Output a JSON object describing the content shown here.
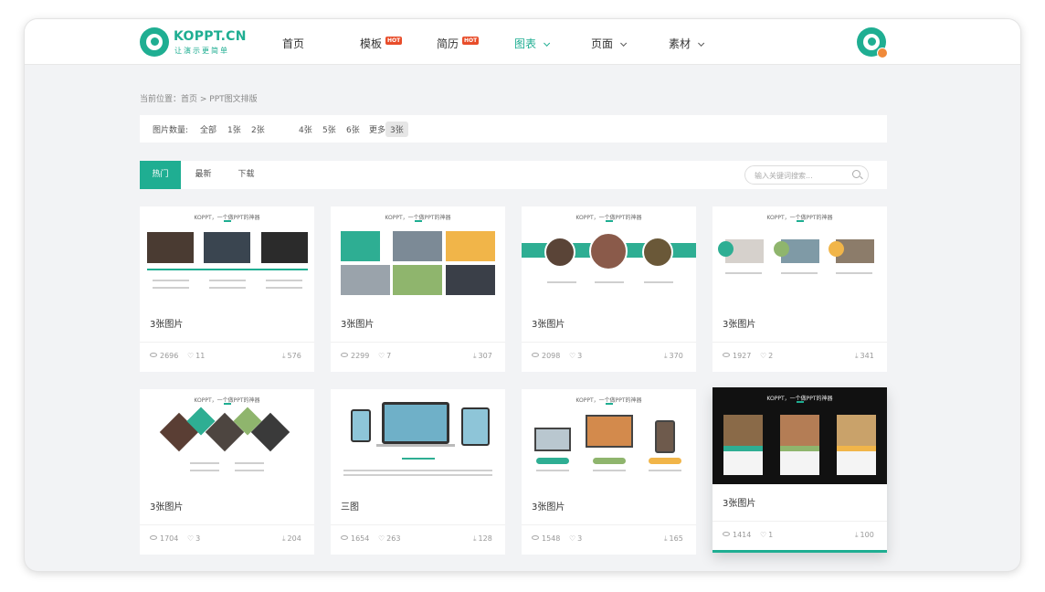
{
  "header": {
    "logo": {
      "title": "KOPPT.CN",
      "tagline": "让演示更简单"
    },
    "nav": [
      {
        "label": "首页",
        "hot": false,
        "dropdown": false,
        "active": false
      },
      {
        "label": "模板",
        "hot": true,
        "dropdown": false,
        "active": false
      },
      {
        "label": "简历",
        "hot": true,
        "dropdown": false,
        "active": false
      },
      {
        "label": "图表",
        "hot": false,
        "dropdown": true,
        "active": true
      },
      {
        "label": "页面",
        "hot": false,
        "dropdown": true,
        "active": false
      },
      {
        "label": "素材",
        "hot": false,
        "dropdown": true,
        "active": false
      }
    ],
    "hot_badge": "HOT"
  },
  "breadcrumb": "当前位置：首页 > PPT图文排版",
  "filter": {
    "label": "图片数量:",
    "options": [
      "全部",
      "1张",
      "2张",
      "3张",
      "4张",
      "5张",
      "6张",
      "更多"
    ],
    "selected": "3张"
  },
  "tabs": [
    "热门",
    "最新",
    "下载"
  ],
  "active_tab": "热门",
  "search": {
    "placeholder": "输入关键词搜索..."
  },
  "thumb_heading": "KOPPT，一个做PPT的神器",
  "cards": [
    {
      "title": "3张图片",
      "views": "2696",
      "likes": "11",
      "downloads": "576"
    },
    {
      "title": "3张图片",
      "views": "2299",
      "likes": "7",
      "downloads": "307"
    },
    {
      "title": "3张图片",
      "views": "2098",
      "likes": "3",
      "downloads": "370"
    },
    {
      "title": "3张图片",
      "views": "1927",
      "likes": "2",
      "downloads": "341"
    },
    {
      "title": "3张图片",
      "views": "1704",
      "likes": "3",
      "downloads": "204"
    },
    {
      "title": "三图",
      "views": "1654",
      "likes": "263",
      "downloads": "128"
    },
    {
      "title": "3张图片",
      "views": "1548",
      "likes": "3",
      "downloads": "165"
    },
    {
      "title": "3张图片",
      "views": "1414",
      "likes": "1",
      "downloads": "100"
    }
  ],
  "colors": {
    "accent": "#1fae92",
    "hot": "#e84d2a",
    "frame_bg": "#f2f3f5"
  }
}
